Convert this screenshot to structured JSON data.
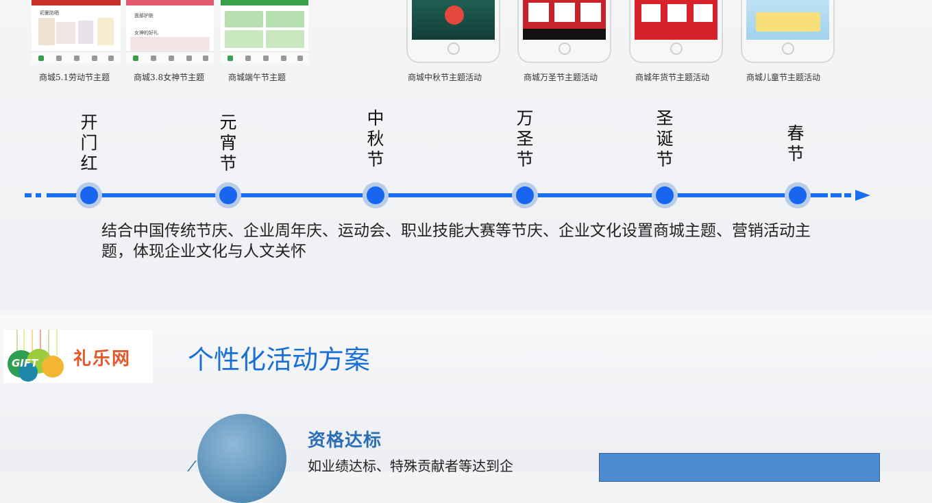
{
  "themes": [
    {
      "caption": "商城5.1劳动节主题",
      "tag": "初夏防晒"
    },
    {
      "caption": "商城3.8女神节主题",
      "tag": "面部护肤",
      "tag2": "女神的好礼"
    },
    {
      "caption": "商城端午节主题"
    },
    {
      "caption": "商城中秋节主题活动"
    },
    {
      "caption": "商城万圣节主题活动"
    },
    {
      "caption": "商城年货节主题活动"
    },
    {
      "caption": "商城儿童节主题活动"
    }
  ],
  "timeline": {
    "labels": [
      "开\n门\n红",
      "元\n宵\n节",
      "中\n秋\n节",
      "万\n圣\n节",
      "圣\n诞\n节",
      "春\n节"
    ],
    "description": "结合中国传统节庆、企业周年庆、运动会、职业技能大赛等节庆、企业文化设置商城主题、营销活动主题，体现企业文化与人文关怀"
  },
  "logo": {
    "text": "礼乐网",
    "mark": "GIFT"
  },
  "section": {
    "heading": "个性化活动方案",
    "item_title": "资格达标",
    "item_text": "如业绩达标、特殊贡献者等达到企"
  },
  "colors": {
    "accent": "#1a6ff0",
    "heading": "#1a6fd6",
    "logo": "#e8552a"
  }
}
